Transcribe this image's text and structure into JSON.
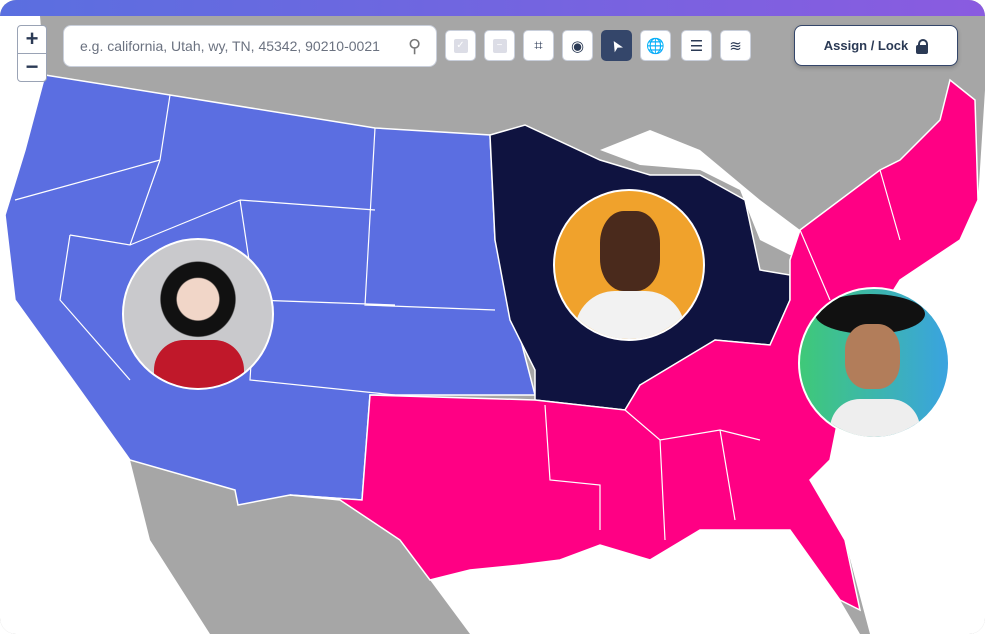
{
  "zoom": {
    "in_label": "+",
    "out_label": "−"
  },
  "search": {
    "placeholder": "e.g. california, Utah, wy, TN, 45342, 90210-0021",
    "icon": "search-icon"
  },
  "tools": [
    {
      "name": "select-all-checkbox",
      "glyph": "✓",
      "state": "disabled"
    },
    {
      "name": "deselect-checkbox",
      "glyph": "−",
      "state": "disabled"
    },
    {
      "name": "lasso-tool",
      "glyph": "⌗",
      "state": "normal"
    },
    {
      "name": "radius-tool",
      "glyph": "◉",
      "state": "normal"
    },
    {
      "name": "pointer-tool",
      "glyph": "➤",
      "state": "active"
    },
    {
      "name": "globe-tool",
      "glyph": "🌐",
      "state": "normal"
    },
    {
      "name": "filters-tool",
      "glyph": "☰",
      "state": "normal"
    },
    {
      "name": "layers-tool",
      "glyph": "≋",
      "state": "normal"
    }
  ],
  "assign": {
    "label": "Assign / Lock",
    "icon": "lock-icon"
  },
  "colors": {
    "west": "#5b6ee1",
    "midwest": "#0f1340",
    "southeast": "#ff0084",
    "land": "#a6a6a6",
    "water": "#ffffff"
  },
  "territories": [
    {
      "region": "west",
      "avatar": "woman-short-hair"
    },
    {
      "region": "midwest",
      "avatar": "man-sunglasses"
    },
    {
      "region": "southeast",
      "avatar": "woman-hat"
    }
  ]
}
